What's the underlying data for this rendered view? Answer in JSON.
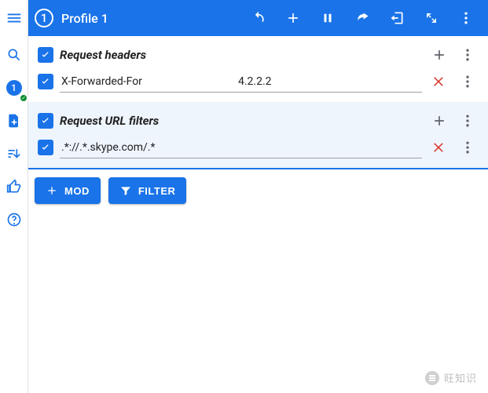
{
  "sidebar": {
    "badge_number": "1"
  },
  "header": {
    "profile_number": "1",
    "profile_title": "Profile 1"
  },
  "sections": [
    {
      "title": "Request headers",
      "rows": [
        {
          "key": "X-Forwarded-For",
          "value": "4.2.2.2"
        }
      ]
    },
    {
      "title": "Request URL filters",
      "rows": [
        {
          "key": ".*://.*.skype.com/.*",
          "value": ""
        }
      ]
    }
  ],
  "buttons": {
    "mod_label": "MOD",
    "filter_label": "FILTER"
  },
  "watermark": "旺知识"
}
